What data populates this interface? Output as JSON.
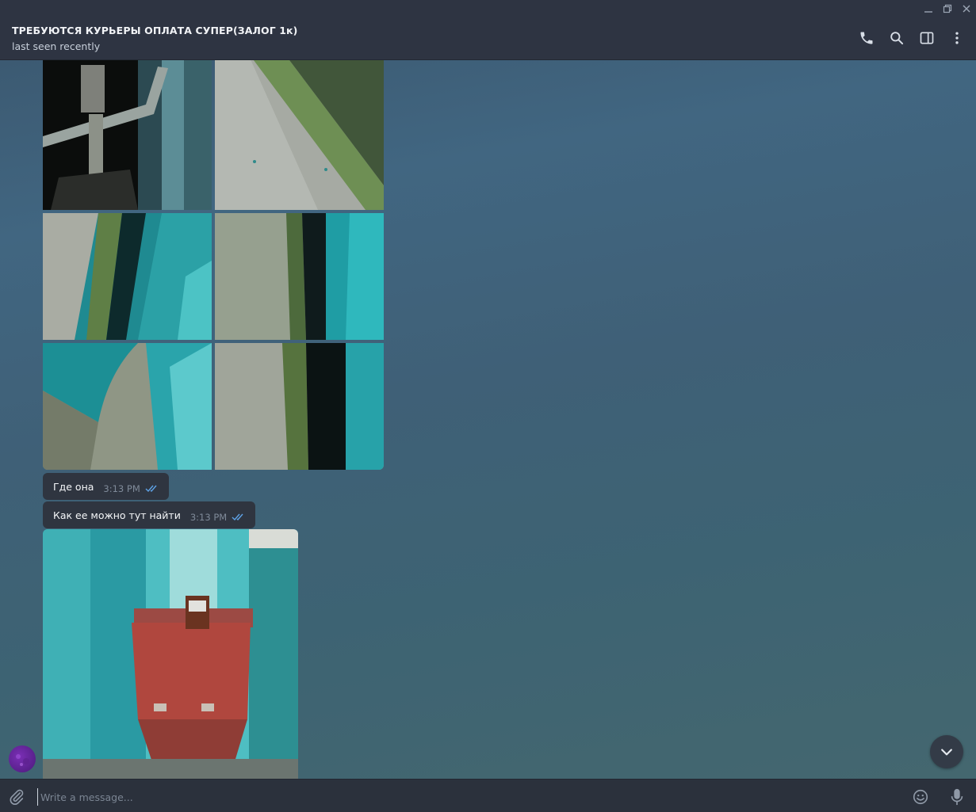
{
  "window": {
    "minimize_icon": "minimize-icon",
    "maximize_icon": "restore-icon",
    "close_icon": "close-icon"
  },
  "header": {
    "title": "ТРЕБУЮТСЯ КУРЬЕРЫ ОПЛАТА СУПЕР(ЗАЛОГ 1к)",
    "status": "last seen recently",
    "actions": [
      "phone-icon",
      "search-icon",
      "sidebar-toggle-icon",
      "more-vertical-icon"
    ]
  },
  "messages": [
    {
      "type": "album",
      "photo_count": 6
    },
    {
      "type": "text",
      "text": "Где она",
      "time": "3:13 PM",
      "status": "read"
    },
    {
      "type": "text",
      "text": "Как ее можно тут найти",
      "time": "3:13 PM",
      "status": "read"
    },
    {
      "type": "photo"
    }
  ],
  "composer": {
    "placeholder": "Write a message...",
    "attach_icon": "paperclip-icon",
    "emoji_icon": "emoji-icon",
    "mic_icon": "microphone-icon"
  },
  "colors": {
    "header_bg": "#2e3442",
    "bubble_bg": "#2f3540",
    "read_check": "#5ea2e6",
    "chat_bg": "#3f6077"
  }
}
